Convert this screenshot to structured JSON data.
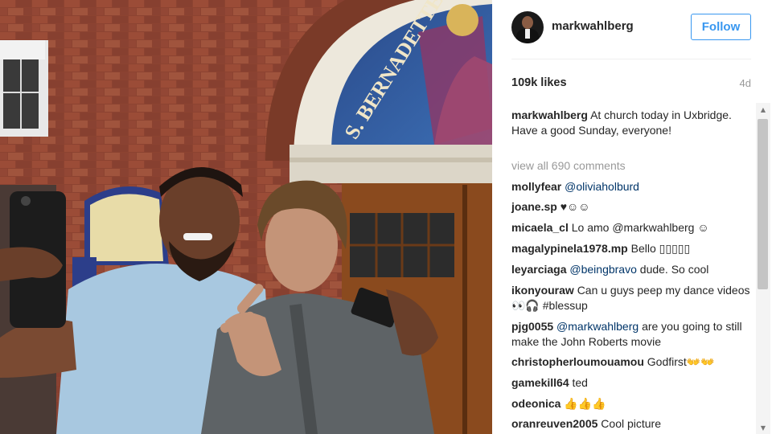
{
  "post": {
    "username": "markwahlberg",
    "follow_label": "Follow",
    "likes": "109k likes",
    "age": "4d",
    "sign_text": "S. BERNADETTE"
  },
  "caption": {
    "user": "markwahlberg",
    "text": "At church today in Uxbridge. Have a good Sunday, everyone!"
  },
  "view_all_label": "view all 690 comments",
  "comments": [
    {
      "user": "mollyfear",
      "mention": "@oliviaholburd",
      "text": ""
    },
    {
      "user": "joane.sp",
      "mention": "",
      "text": "♥☺☺"
    },
    {
      "user": "micaela_cl",
      "mention": "",
      "text": "Lo amo @markwahlberg ☺"
    },
    {
      "user": "magalypinela1978.mp",
      "mention": "",
      "text": "Bello ▯▯▯▯▯"
    },
    {
      "user": "leyarciaga",
      "mention": "@beingbravo",
      "text": "dude. So cool"
    },
    {
      "user": "ikonyouraw",
      "mention": "",
      "text": "Can u guys peep my dance videos 👀🎧 #blessup"
    },
    {
      "user": "pjg0055",
      "mention": "@markwahlberg",
      "text": "are you going to still make the John Roberts movie"
    },
    {
      "user": "christopherloumouamou",
      "mention": "",
      "text": "Godfirst👐👐"
    },
    {
      "user": "gamekill64",
      "mention": "",
      "text": "ted"
    },
    {
      "user": "odeonica",
      "mention": "",
      "text": "👍👍👍"
    },
    {
      "user": "oranreuven2005",
      "mention": "",
      "text": "Cool picture"
    }
  ],
  "icons": {
    "avatar": "profile-avatar",
    "scroll_up": "chevron-up-icon",
    "scroll_down": "chevron-down-icon"
  },
  "colors": {
    "accent": "#3897f0",
    "link": "#003569",
    "muted": "#999999"
  }
}
